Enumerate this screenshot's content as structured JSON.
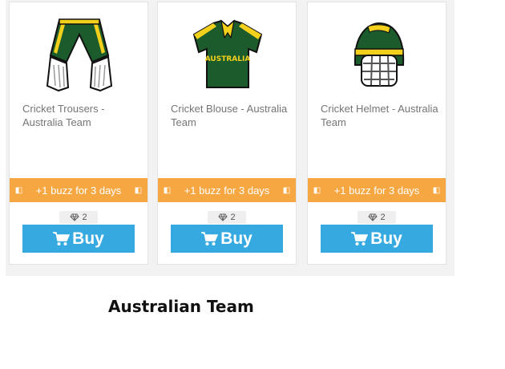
{
  "products": [
    {
      "title": "Cricket Trousers - Australia Team",
      "image_icon": "cricket-trousers-icon",
      "buzz_text": "+1 buzz for 3 days",
      "gem_count": "2",
      "buy_label": "Buy"
    },
    {
      "title": "Cricket Blouse - Australia Team",
      "image_icon": "cricket-jersey-icon",
      "jersey_text": "AUSTRALIA",
      "buzz_text": "+1 buzz for 3 days",
      "gem_count": "2",
      "buy_label": "Buy"
    },
    {
      "title": "Cricket Helmet - Australia Team",
      "image_icon": "cricket-helmet-icon",
      "buzz_text": "+1 buzz for 3 days",
      "gem_count": "2",
      "buy_label": "Buy"
    }
  ],
  "caption": "Australian Team",
  "colors": {
    "team_green": "#1c5c2c",
    "team_gold": "#f2d01c",
    "buzz_orange": "#f7a742",
    "buy_blue": "#35a9e0"
  }
}
